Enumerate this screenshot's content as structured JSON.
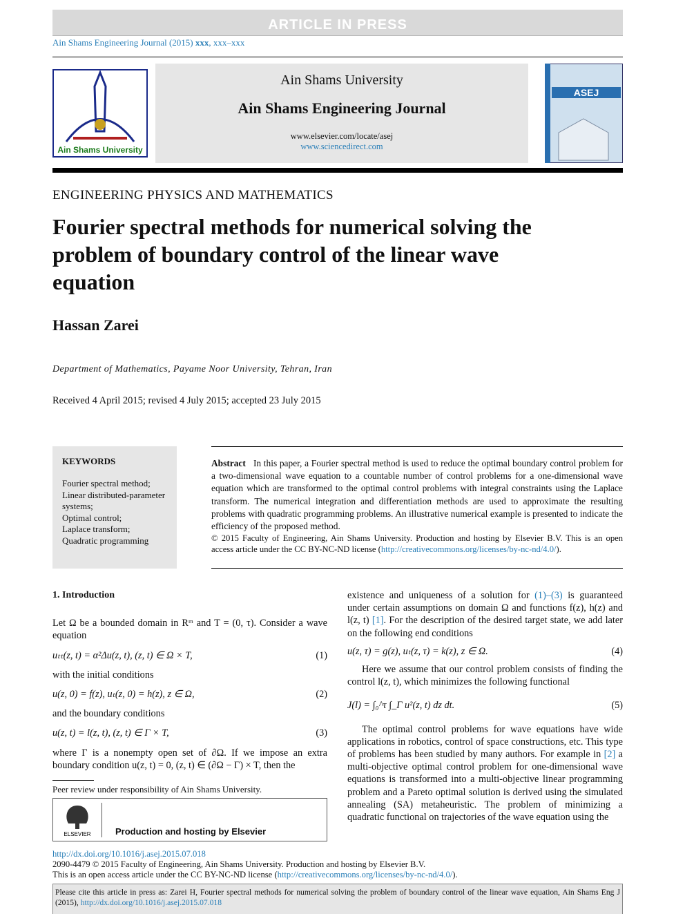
{
  "banner": "ARTICLE IN PRESS",
  "journal_ref": {
    "prefix": "Ain Shams Engineering Journal (2015) ",
    "bold": "xxx",
    "suffix": ", xxx–xxx"
  },
  "masthead": {
    "university": "Ain Shams University",
    "journal": "Ain Shams Engineering Journal",
    "url1": "www.elsevier.com/locate/asej",
    "url2": "www.sciencedirect.com"
  },
  "logo": {
    "text": "Ain Shams University"
  },
  "cover": {
    "text": "ASEJ"
  },
  "section": "ENGINEERING PHYSICS AND MATHEMATICS",
  "title": "Fourier spectral methods for numerical solving the problem of boundary control of the linear wave equation",
  "author": "Hassan Zarei",
  "affiliation": "Department of Mathematics, Payame Noor University, Tehran, Iran",
  "dates": "Received 4 April 2015; revised 4 July 2015; accepted 23 July 2015",
  "keywords": {
    "title": "KEYWORDS",
    "items": [
      "Fourier spectral method;",
      "Linear distributed-parameter systems;",
      "Optimal control;",
      "Laplace transform;",
      "Quadratic programming"
    ]
  },
  "abstract": {
    "label": "Abstract",
    "text": "In this paper, a Fourier spectral method is used to reduce the optimal boundary control problem for a two-dimensional wave equation to a countable number of control problems for a one-dimensional wave equation which are transformed to the optimal control problems with integral constraints using the Laplace transform. The numerical integration and differentiation methods are used to approximate the resulting problems with quadratic programming problems. An illustrative numerical example is presented to indicate the efficiency of the proposed method.",
    "copyright": "© 2015 Faculty of Engineering, Ain Shams University. Production and hosting by Elsevier B.V. This is an open access article under the CC BY-NC-ND license (",
    "license_url": "http://creativecommons.org/licenses/by-nc-nd/4.0/",
    "close": ")."
  },
  "left_col": {
    "heading": "1. Introduction",
    "p1": "Let Ω be a bounded domain in Rᵐ and T = (0, τ). Consider a wave equation",
    "eq1": "uₜₜ(z, t) = α²Δu(z, t),    (z, t) ∈ Ω × T,",
    "eq1_num": "(1)",
    "p2": "with the initial conditions",
    "eq2": "u(z, 0) = f(z),    uₜ(z, 0) = h(z),    z ∈ Ω,",
    "eq2_num": "(2)",
    "p3": "and the boundary conditions",
    "eq3": "u(z, t) = l(z, t),    (z, t) ∈ Γ × T,",
    "eq3_num": "(3)",
    "p4": "where Γ is a nonempty open set of ∂Ω. If we impose an extra boundary condition u(z, t) = 0, (z, t) ∈ (∂Ω − Γ) × T, then the"
  },
  "right_col": {
    "p1a": "existence and uniqueness of a solution for ",
    "p1_link": "(1)–(3)",
    "p1b": " is guaranteed under certain assumptions on domain Ω and functions f(z), h(z) and l(z, t) ",
    "p1_ref": "[1]",
    "p1c": ". For the description of the desired target state, we add later on the following end conditions",
    "eq4": "u(z, τ) = g(z),    uₜ(z, τ) = k(z),    z ∈ Ω.",
    "eq4_num": "(4)",
    "p2": "Here we assume that our control problem consists of finding the control l(z, t), which minimizes the following functional",
    "eq5": "J(l) = ∫₀^τ ∫_Γ u²(z, t) dz dt.",
    "eq5_num": "(5)",
    "p3a": "The optimal control problems for wave equations have wide applications in robotics, control of space constructions, etc. This type of problems has been studied by many authors. For example in ",
    "p3_ref": "[2]",
    "p3b": " a multi-objective optimal control problem for one-dimensional wave equations is transformed into a multi-objective linear programming problem and a Pareto optimal solution is derived using the simulated annealing (SA) metaheuristic. The problem of minimizing a quadratic functional on trajectories of the wave equation using the"
  },
  "footnote": {
    "peer": "Peer review under responsibility of Ain Shams University.",
    "elsevier_logo": "ELSEVIER",
    "production": "Production and hosting by Elsevier"
  },
  "footer": {
    "doi": "http://dx.doi.org/10.1016/j.asej.2015.07.018",
    "issn": "2090-4479 © 2015 Faculty of Engineering, Ain Shams University. Production and hosting by Elsevier B.V.",
    "license_pre": "This is an open access article under the CC BY-NC-ND license (",
    "license_url": "http://creativecommons.org/licenses/by-nc-nd/4.0/",
    "license_post": ")."
  },
  "cite": {
    "text": "Please cite this article in press as: Zarei H, Fourier spectral methods for numerical solving the problem of boundary control of the linear wave equation, Ain Shams Eng J (2015), ",
    "doi": "http://dx.doi.org/10.1016/j.asej.2015.07.018"
  }
}
